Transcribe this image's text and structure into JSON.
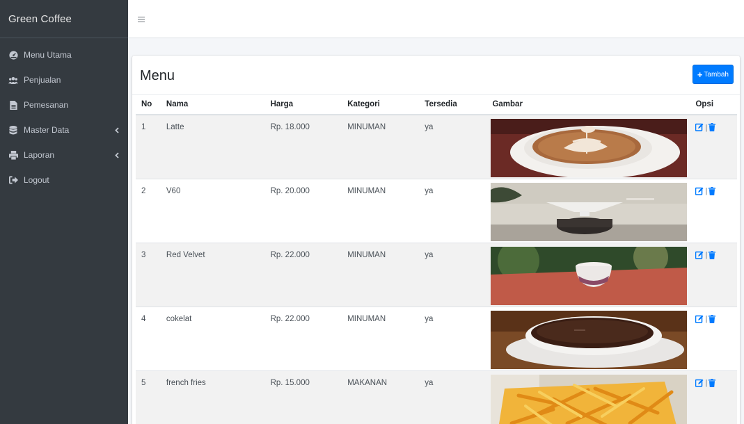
{
  "app": {
    "brand": "Green Coffee"
  },
  "sidebar": {
    "items": [
      {
        "label": "Menu Utama",
        "icon": "tachometer-icon",
        "has_chevron": false
      },
      {
        "label": "Penjualan",
        "icon": "users-icon",
        "has_chevron": false
      },
      {
        "label": "Pemesanan",
        "icon": "file-icon",
        "has_chevron": false
      },
      {
        "label": "Master Data",
        "icon": "database-icon",
        "has_chevron": true
      },
      {
        "label": "Laporan",
        "icon": "print-icon",
        "has_chevron": true
      },
      {
        "label": "Logout",
        "icon": "sign-out-icon",
        "has_chevron": false
      }
    ]
  },
  "card": {
    "title": "Menu",
    "add_button_label": "Tambah"
  },
  "table": {
    "headers": [
      "No",
      "Nama",
      "Harga",
      "Kategori",
      "Tersedia",
      "Gambar",
      "Opsi"
    ],
    "rows": [
      {
        "no": "1",
        "nama": "Latte",
        "harga": "Rp. 18.000",
        "kategori": "MINUMAN",
        "tersedia": "ya",
        "image": "latte-photo"
      },
      {
        "no": "2",
        "nama": "V60",
        "harga": "Rp. 20.000",
        "kategori": "MINUMAN",
        "tersedia": "ya",
        "image": "v60-photo"
      },
      {
        "no": "3",
        "nama": "Red Velvet",
        "harga": "Rp. 22.000",
        "kategori": "MINUMAN",
        "tersedia": "ya",
        "image": "red-velvet-photo"
      },
      {
        "no": "4",
        "nama": "cokelat",
        "harga": "Rp. 22.000",
        "kategori": "MINUMAN",
        "tersedia": "ya",
        "image": "cokelat-photo"
      },
      {
        "no": "5",
        "nama": "french fries",
        "harga": "Rp. 15.000",
        "kategori": "MAKANAN",
        "tersedia": "ya",
        "image": "french-fries-photo"
      }
    ],
    "action_separator": "|"
  },
  "colors": {
    "sidebar_bg": "#343a40",
    "sidebar_text": "#c2c7d0",
    "primary": "#007bff",
    "row_stripe": "#f2f2f2"
  }
}
